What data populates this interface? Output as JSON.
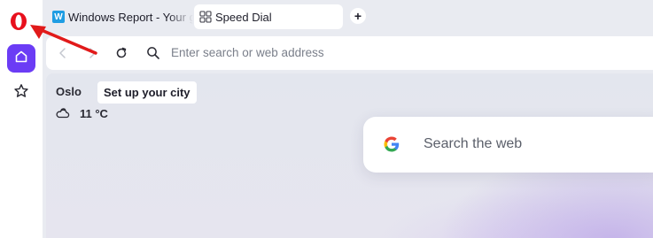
{
  "sidebar": {
    "logo_icon": "opera-logo-icon",
    "home_icon": "home-icon",
    "bookmarks_icon": "star-icon",
    "accent": "#6b3cf5",
    "logo_color": "#e8101d"
  },
  "tabs": [
    {
      "label": "Windows Report - Your go",
      "favicon": "W",
      "active": false
    },
    {
      "label": "Speed Dial",
      "favicon": "speed-dial-icon",
      "active": true
    }
  ],
  "new_tab_label": "+",
  "address_bar": {
    "placeholder": "Enter search or web address",
    "back_icon": "chevron-left-icon",
    "forward_icon": "chevron-right-icon",
    "reload_icon": "reload-icon",
    "search_icon": "search-icon"
  },
  "weather": {
    "city": "Oslo",
    "setup_prompt": "Set up your city",
    "temperature": "11 °C",
    "condition_icon": "cloud-icon"
  },
  "search": {
    "placeholder": "Search the web",
    "engine_icon": "google-icon"
  },
  "annotation": {
    "color": "#e11a1a",
    "icon": "red-arrow"
  }
}
